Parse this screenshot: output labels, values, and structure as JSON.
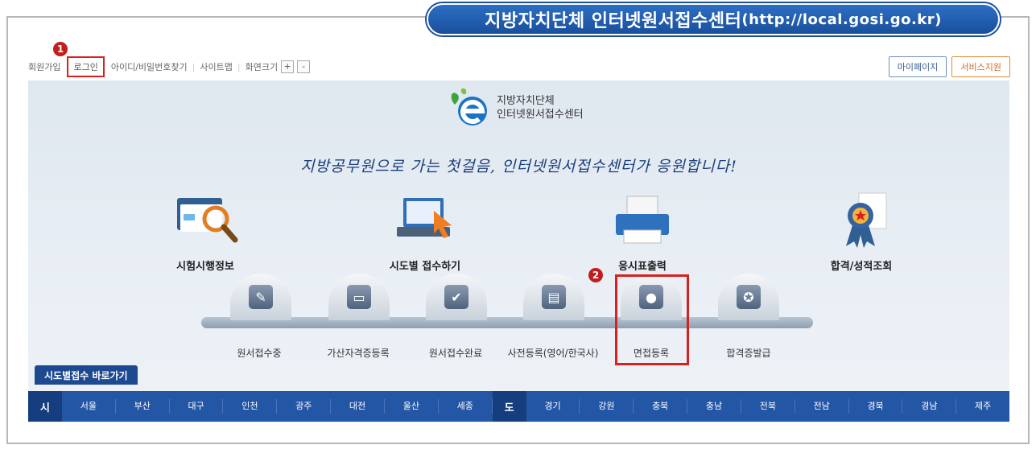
{
  "banner": {
    "title": "지방자치단체 인터넷원서접수센터",
    "url": "(http://local.gosi.go.kr)"
  },
  "util": {
    "signup": "회원가입",
    "login": "로그인",
    "find": "아이디/비밀번호찾기",
    "sitemap": "사이트맵",
    "zoom": "화면크기",
    "zoom_in": "+",
    "zoom_out": "-"
  },
  "annotations": {
    "one": "1",
    "two": "2"
  },
  "topright": {
    "mypage": "마이페이지",
    "support": "서비스지원"
  },
  "logo": {
    "line1": "지방자치단체",
    "line2": "인터넷원서접수센터"
  },
  "slogan": "지방공무원으로 가는 첫걸음, 인터넷원서접수센터가 응원합니다!",
  "menu": [
    {
      "label": "시험시행정보",
      "icon": "magnifier-folder-icon"
    },
    {
      "label": "시도별 접수하기",
      "icon": "laptop-cursor-icon"
    },
    {
      "label": "응시표출력",
      "icon": "printer-icon"
    },
    {
      "label": "합격/성적조회",
      "icon": "award-ribbon-icon"
    }
  ],
  "steps": [
    {
      "label": "원서접수중",
      "icon": "pencil-icon"
    },
    {
      "label": "가산자격증등록",
      "icon": "id-card-icon"
    },
    {
      "label": "원서접수완료",
      "icon": "checkbox-icon"
    },
    {
      "label": "사전등록(영어/한국사)",
      "icon": "document-edit-icon"
    },
    {
      "label": "면접등록",
      "icon": "person-icon"
    },
    {
      "label": "합격증발급",
      "icon": "medal-icon"
    }
  ],
  "shortcut_label": "시도별접수 바로가기",
  "regions": {
    "si_head": "시",
    "si": [
      "서울",
      "부산",
      "대구",
      "인천",
      "광주",
      "대전",
      "울산",
      "세종"
    ],
    "do_head": "도",
    "do": [
      "경기",
      "강원",
      "충북",
      "충남",
      "전북",
      "전남",
      "경북",
      "경남",
      "제주"
    ]
  },
  "colors": {
    "brand": "#1d4990",
    "highlight": "#d9201f",
    "bar": "#2456a6"
  }
}
